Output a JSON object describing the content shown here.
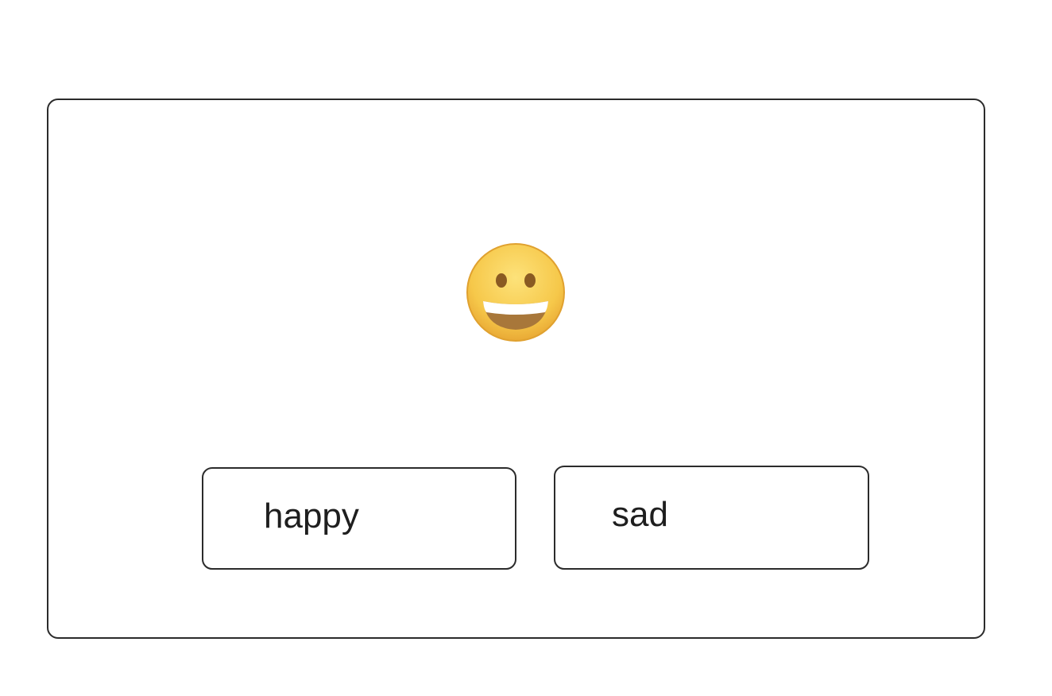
{
  "prompt": {
    "emoji_icon": "grinning-face-icon",
    "emoji_char": "😀"
  },
  "choices": [
    {
      "label": "happy"
    },
    {
      "label": "sad"
    }
  ],
  "colors": {
    "border": "#2b2b2b",
    "text": "#1e1e1e",
    "face": "#f6c84a",
    "face_edge": "#e0a12f",
    "mouth": "#a8773a",
    "teeth": "#ffffff"
  }
}
